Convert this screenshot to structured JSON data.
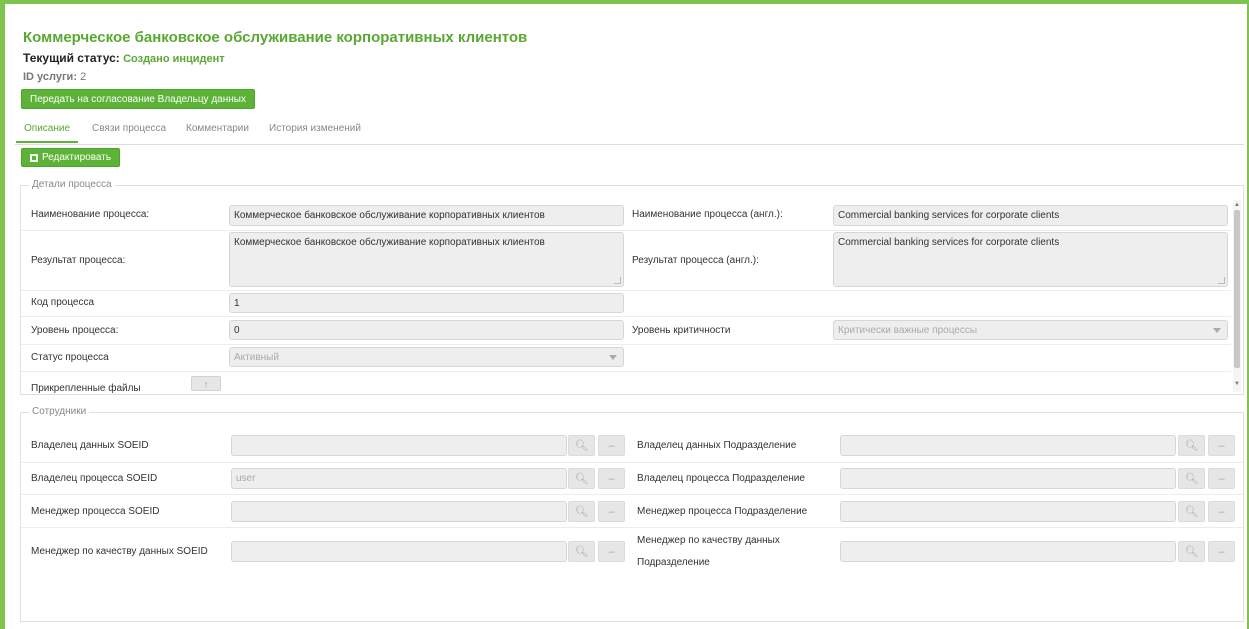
{
  "header": {
    "title": "Коммерческое банковское обслуживание корпоративных клиентов",
    "status_label": "Текущий статус:",
    "status_value": "Создано инцидент",
    "id_label": "ID услуги:",
    "id_value": "2",
    "submit_button": "Передать на согласование Владельцу данных"
  },
  "tabs": [
    {
      "label": "Описание",
      "active": true
    },
    {
      "label": "Связи процесса",
      "active": false
    },
    {
      "label": "Комментарии",
      "active": false
    },
    {
      "label": "История изменений",
      "active": false
    }
  ],
  "edit_button": "Редактировать",
  "details": {
    "legend": "Детали процесса",
    "name_label": "Наименование процесса:",
    "name_value": "Коммерческое банковское обслуживание корпоративных клиентов",
    "name_en_label": "Наименование процесса (англ.):",
    "name_en_value": "Commercial banking services for corporate clients",
    "result_label": "Результат процесса:",
    "result_value": "Коммерческое банковское обслуживание корпоративных клиентов",
    "result_en_label": "Результат процесса (англ.):",
    "result_en_value": "Commercial banking services for corporate clients",
    "code_label": "Код процесса",
    "code_value": "1",
    "level_label": "Уровень процесса:",
    "level_value": "0",
    "criticality_label": "Уровень критичности",
    "criticality_value": "Критически важные процессы",
    "status_label": "Статус процесса",
    "status_value": "Активный",
    "files_label": "Прикрепленные файлы"
  },
  "staff": {
    "legend": "Сотрудники",
    "data_owner_label": "Владелец данных SOEID",
    "data_owner_value": "",
    "data_owner_dept_label": "Владелец данных Подразделение",
    "data_owner_dept_value": "",
    "process_owner_label": "Владелец процесса SOEID",
    "process_owner_value": "user",
    "process_owner_dept_label": "Владелец процесса Подразделение",
    "process_owner_dept_value": "",
    "process_manager_label": "Менеджер процесса SOEID",
    "process_manager_value": "",
    "process_manager_dept_label": "Менеджер процесса Подразделение",
    "process_manager_dept_value": "",
    "quality_manager_label": "Менеджер по качеству данных SOEID",
    "quality_manager_value": "",
    "quality_manager_dept_label_1": "Менеджер по качеству данных",
    "quality_manager_dept_label_2": "Подразделение",
    "quality_manager_dept_value": ""
  },
  "icons": {
    "search": "search-icon",
    "remove": "minus-icon",
    "edit": "edit-icon",
    "upload": "upload-icon"
  },
  "colors": {
    "accent": "#5aa832",
    "button": "#5cb338",
    "border": "#7dc34e"
  }
}
